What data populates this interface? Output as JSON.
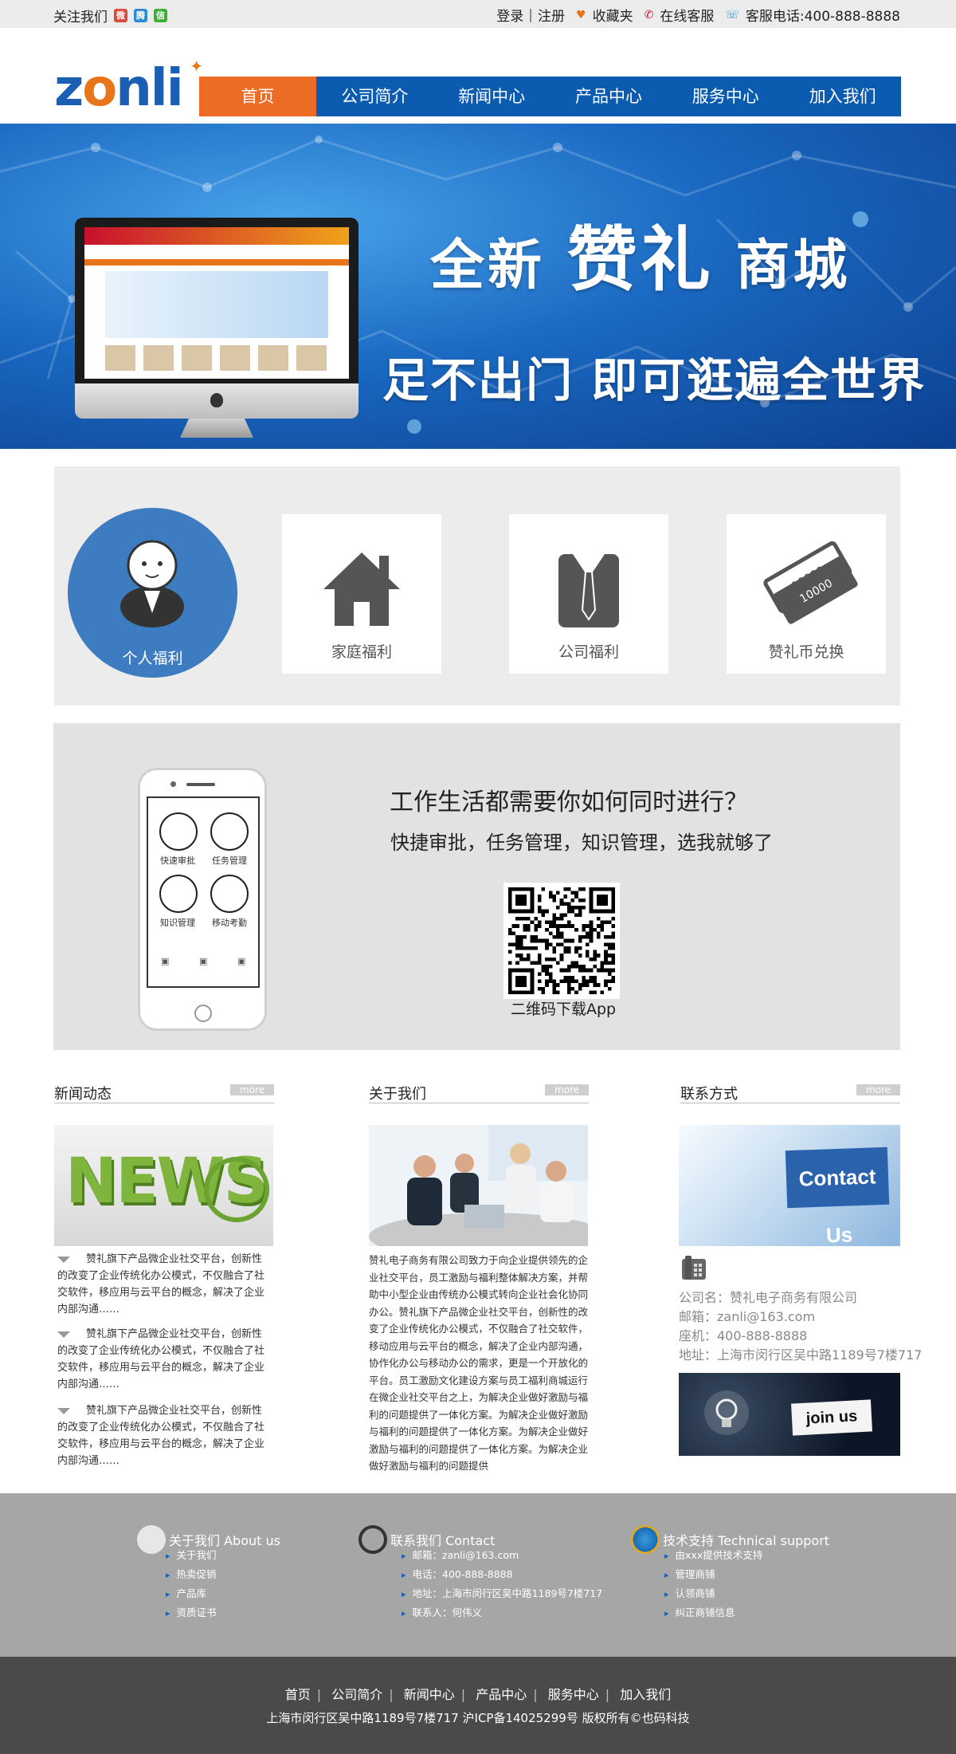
{
  "topbar": {
    "follow": "关注我们",
    "social_icons": [
      "weibo-icon",
      "tencent-weibo-icon",
      "wechat-icon"
    ],
    "login": "登录",
    "register": "注册",
    "favorites": "收藏夹",
    "online_service": "在线客服",
    "hotline": "客服电话:400-888-8888"
  },
  "logo": {
    "text": "zonli"
  },
  "nav": {
    "items": [
      "首页",
      "公司简介",
      "新闻中心",
      "产品中心",
      "服务中心",
      "加入我们"
    ],
    "active_color": "#ec6c23",
    "bar_color": "#0b5bb0"
  },
  "banner": {
    "title_prefix": "全新",
    "title_brand": "赞礼",
    "title_suffix": "商城",
    "slogan": "足不出门 即可逛遍全世界"
  },
  "welfare": {
    "items": [
      {
        "label": "个人福利",
        "icon": "person-icon"
      },
      {
        "label": "家庭福利",
        "icon": "house-icon"
      },
      {
        "label": "公司福利",
        "icon": "suit-icon"
      },
      {
        "label": "赞礼币兑换",
        "icon": "voucher-icon"
      }
    ]
  },
  "app": {
    "question": "工作生活都需要你如何同时进行？",
    "subtitle": "快捷审批，任务管理，知识管理，选我就够了",
    "qr_label": "二维码下载App",
    "phone_apps": [
      "快速审批",
      "任务管理",
      "知识管理",
      "移动考勤"
    ]
  },
  "columns": {
    "news": {
      "title": "新闻动态",
      "more": "more",
      "image_text": "NEWS",
      "items": [
        "赞礼旗下产品微企业社交平台，创新性的改变了企业传统化办公模式，不仅融合了社交软件，移应用与云平台的概念，解决了企业内部沟通……",
        "赞礼旗下产品微企业社交平台，创新性的改变了企业传统化办公模式，不仅融合了社交软件，移应用与云平台的概念，解决了企业内部沟通……",
        "赞礼旗下产品微企业社交平台，创新性的改变了企业传统化办公模式，不仅融合了社交软件，移应用与云平台的概念，解决了企业内部沟通……"
      ]
    },
    "about": {
      "title": "关于我们",
      "more": "more",
      "text": "赞礼电子商务有限公司致力于向企业提供领先的企业社交平台，员工激励与福利整体解决方案，并帮助中小型企业由传统办公模式转向企业社会化协同办公。赞礼旗下产品微企业社交平台，创新性的改变了企业传统化办公模式，不仅融合了社交软件，移动应用与云平台的概念，解决了企业内部沟通，协作化办公与移动办公的需求，更是一个开放化的平台。员工激励文化建设方案与员工福利商城运行在微企业社交平台之上，为解决企业做好激励与福利的问题提供了一体化方案。为解决企业做好激励与福利的问题提供了一体化方案。为解决企业做好激励与福利的问题提供了一体化方案。为解决企业做好激励与福利的问题提供"
    },
    "contact": {
      "title": "联系方式",
      "more": "more",
      "image_text": "Contact Us",
      "company": "公司名：赞礼电子商务有限公司",
      "email": "邮箱：zanli@163.com",
      "phone": "座机：400-888-8888",
      "address": "地址：上海市闵行区吴中路1189号7楼717",
      "join_text": "join us"
    }
  },
  "footer_links": {
    "about": {
      "title": "关于我们 About us",
      "items": [
        "关于我们",
        "热卖促销",
        "产品库",
        "资质证书"
      ]
    },
    "contact": {
      "title": "联系我们 Contact",
      "items": [
        "邮箱：zanli@163.com",
        "电话：400-888-8888",
        "地址：上海市闵行区吴中路1189号7楼717",
        "联系人：何伟义"
      ]
    },
    "support": {
      "title": "技术支持 Technical support",
      "items": [
        "由xxx提供技术支持",
        "管理商铺",
        "认领商铺",
        "纠正商铺信息"
      ]
    }
  },
  "bottom": {
    "nav": [
      "首页",
      "公司简介",
      "新闻中心",
      "产品中心",
      "服务中心",
      "加入我们"
    ],
    "info": "上海市闵行区吴中路1189号7楼717  沪ICP备14025299号  版权所有©也码科技"
  }
}
